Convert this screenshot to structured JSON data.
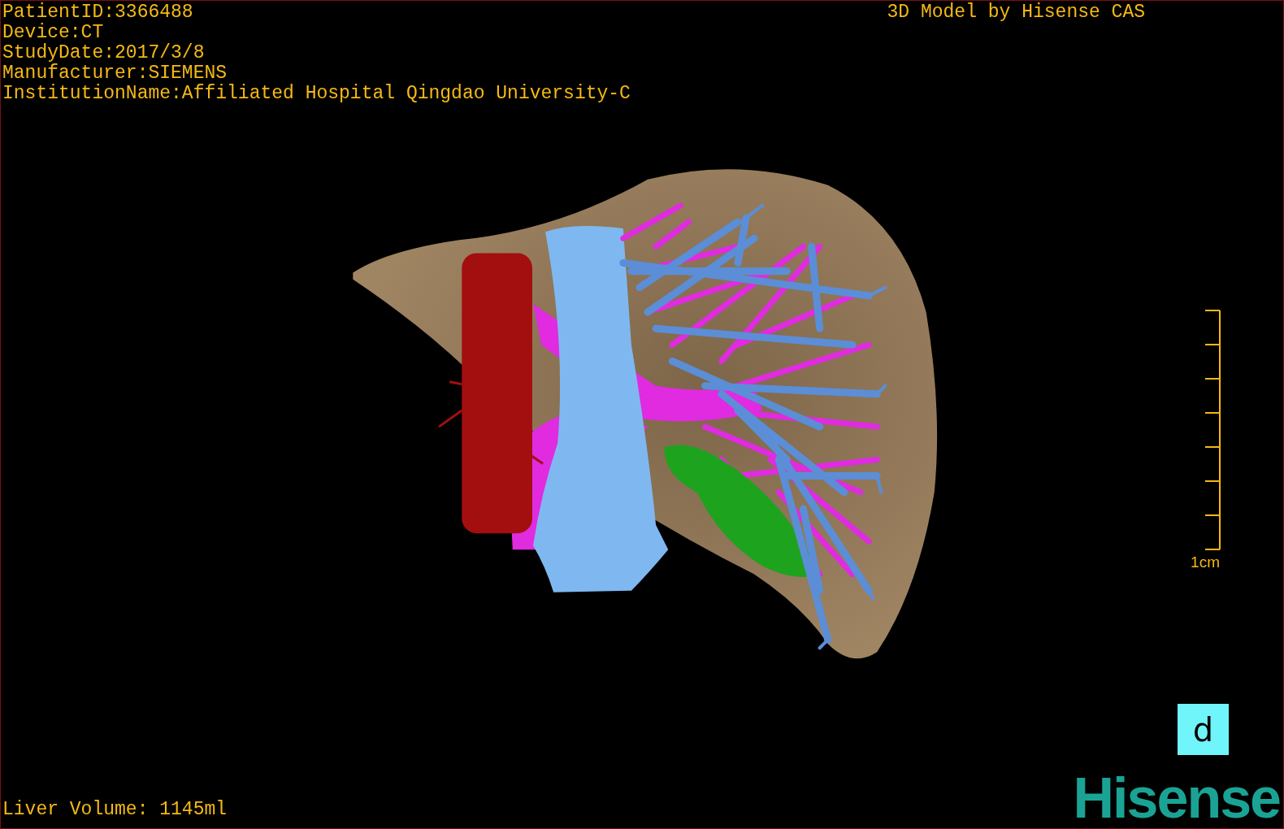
{
  "info_lines": [
    "PatientID:3366488",
    "Device:CT",
    "StudyDate:2017/3/8",
    "Manufacturer:SIEMENS",
    "InstitutionName:Affiliated Hospital Qingdao University-C"
  ],
  "title": "3D Model by Hisense CAS",
  "scale": {
    "label": "1cm"
  },
  "orientation": {
    "label": "d"
  },
  "liver_volume": "Liver Volume: 1145ml",
  "logo": "Hisense"
}
